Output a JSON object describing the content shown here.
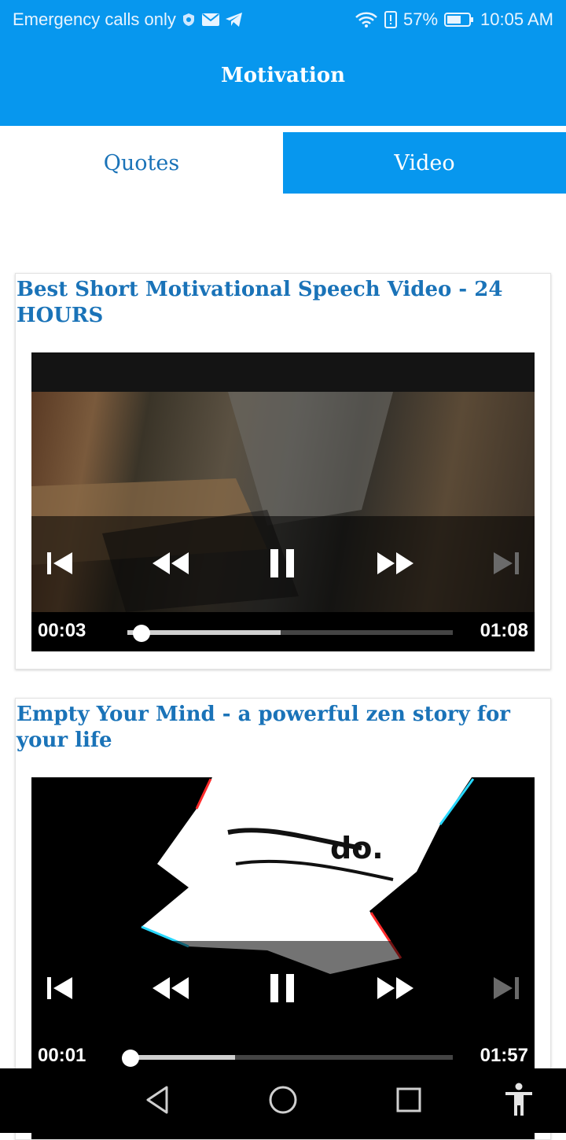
{
  "status_bar": {
    "carrier": "Emergency calls only",
    "battery": "57%",
    "time": "10:05 AM",
    "icons": [
      "shield-icon",
      "mail-icon",
      "telegram-icon",
      "wifi-icon",
      "alert-icon",
      "battery-icon"
    ]
  },
  "app_bar": {
    "title": "Motivation"
  },
  "tabs": [
    {
      "label": "Quotes",
      "active": false
    },
    {
      "label": "Video",
      "active": true
    }
  ],
  "videos": [
    {
      "title": "Best Short Motivational Speech Video - 24 HOURS",
      "current_time": "00:03",
      "duration": "01:08",
      "progress_fraction": 0.044,
      "buffered_fraction": 0.47
    },
    {
      "title": "Empty Your Mind - a powerful zen story for your life",
      "current_time": "00:01",
      "duration": "01:57",
      "progress_fraction": 0.009,
      "buffered_fraction": 0.33,
      "frame_text": "do."
    }
  ],
  "colors": {
    "primary": "#0797ee",
    "title_blue": "#1a73b8"
  },
  "nav_bar": {
    "icons": [
      "back-icon",
      "home-icon",
      "recents-icon",
      "accessibility-icon"
    ]
  }
}
